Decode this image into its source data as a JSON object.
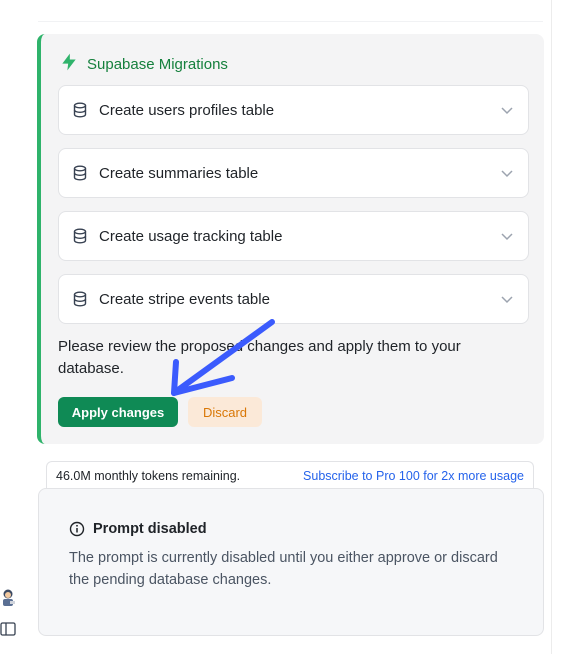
{
  "migrations": {
    "title": "Supabase Migrations",
    "items": [
      {
        "label": "Create users profiles table"
      },
      {
        "label": "Create summaries table"
      },
      {
        "label": "Create usage tracking table"
      },
      {
        "label": "Create stripe events table"
      }
    ],
    "review_text": "Please review the proposed changes and apply them to your database.",
    "apply_label": "Apply changes",
    "discard_label": "Discard"
  },
  "tokens": {
    "remaining": "46.0M monthly tokens remaining.",
    "upgrade_link": "Subscribe to Pro 100 for 2x more usage"
  },
  "prompt": {
    "title": "Prompt disabled",
    "body": "The prompt is currently disabled until you either approve or discard the pending database changes."
  },
  "colors": {
    "accent_green": "#2fb36b",
    "apply_button": "#0f8a55",
    "discard_text": "#d97706",
    "link_blue": "#2563eb",
    "annotation_arrow": "#3b5bfd"
  },
  "icons": {
    "header": "bolt-icon",
    "item": "database-icon",
    "expand": "chevron-down-icon",
    "info": "info-icon"
  }
}
